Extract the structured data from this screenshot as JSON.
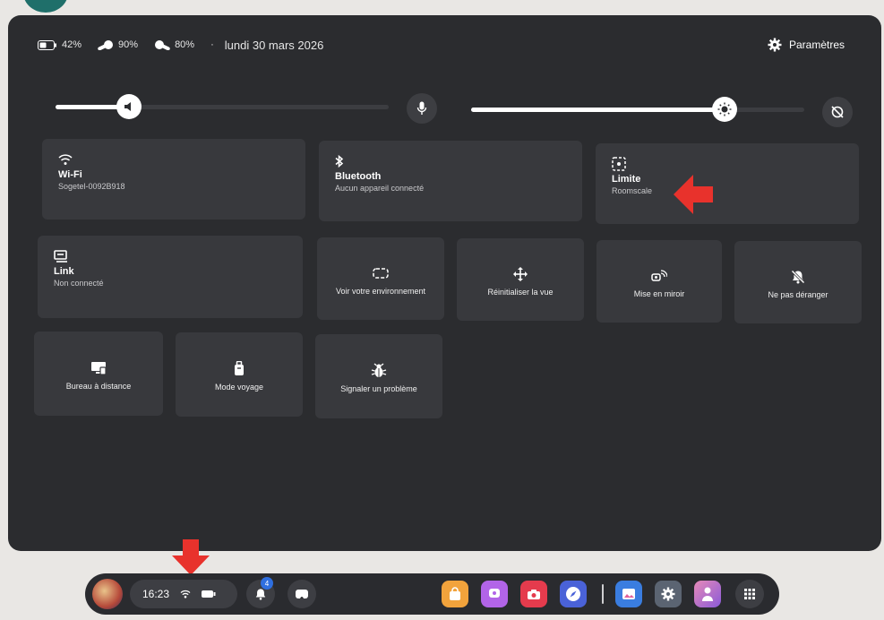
{
  "status": {
    "battery_headset": "42%",
    "battery_controller_right": "90%",
    "battery_controller_left": "80%",
    "separator": "·",
    "date": "lundi 30 mars 2026"
  },
  "settings_label": "Paramètres",
  "sliders": {
    "volume_level": 0.22,
    "brightness_level": 0.76
  },
  "tiles": {
    "wifi": {
      "title": "Wi-Fi",
      "subtitle": "Sogetel-0092B918",
      "icon": "wifi-icon"
    },
    "bluetooth": {
      "title": "Bluetooth",
      "subtitle": "Aucun appareil connecté",
      "icon": "bluetooth-icon"
    },
    "boundary": {
      "title": "Limite",
      "subtitle": "Roomscale",
      "icon": "boundary-icon"
    },
    "link": {
      "title": "Link",
      "subtitle": "Non connecté",
      "icon": "link-icon"
    },
    "passthrough": {
      "label": "Voir votre environnement",
      "icon": "passthrough-icon"
    },
    "reset_view": {
      "label": "Réinitialiser la vue",
      "icon": "move-icon"
    },
    "cast": {
      "label": "Mise en miroir",
      "icon": "cast-icon"
    },
    "dnd": {
      "label": "Ne pas déranger",
      "icon": "bell-off-icon"
    },
    "remote_desktop": {
      "label": "Bureau à distance",
      "icon": "monitor-icon"
    },
    "travel_mode": {
      "label": "Mode voyage",
      "icon": "luggage-icon"
    },
    "report_bug": {
      "label": "Signaler un problème",
      "icon": "bug-icon"
    }
  },
  "taskbar": {
    "time": "16:23",
    "notification_count": "4",
    "apps": [
      "store-app",
      "horizon-app",
      "camera-app",
      "browser-app",
      "gallery-app",
      "settings-app",
      "avatar-app",
      "apps-grid"
    ]
  },
  "colors": {
    "panel": "#2b2c2f",
    "tile": "#38393d",
    "accent_arrow": "#e8322c",
    "notification_badge": "#2f6fe0"
  }
}
